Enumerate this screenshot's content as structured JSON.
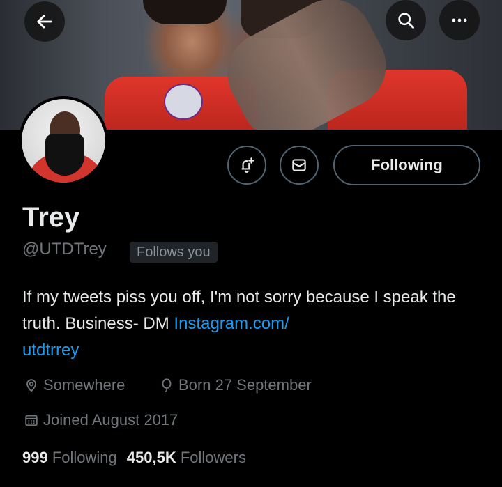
{
  "header": {
    "back_icon": "arrow-left-icon",
    "search_icon": "search-icon",
    "more_icon": "more-icon"
  },
  "profile": {
    "name": "Trey",
    "handle": "@UTDTrey",
    "follows_you": "Follows you",
    "bio_text": "If my tweets piss you off, I'm not sorry because I speak the truth. Business- DM ",
    "bio_link": "Instagram.com/\nutdtrrey",
    "location": "Somewhere",
    "born": "Born 27 September",
    "joined": "Joined August 2017"
  },
  "actions": {
    "notify_icon": "bell-plus-icon",
    "message_icon": "envelope-icon",
    "follow_label": "Following"
  },
  "stats": {
    "following_count": "999",
    "following_label": "Following",
    "followers_count": "450,5K",
    "followers_label": "Followers"
  },
  "colors": {
    "background": "#000000",
    "text": "#e7e9ea",
    "muted": "#71767b",
    "link": "#1d9bf0",
    "border": "#536471"
  }
}
